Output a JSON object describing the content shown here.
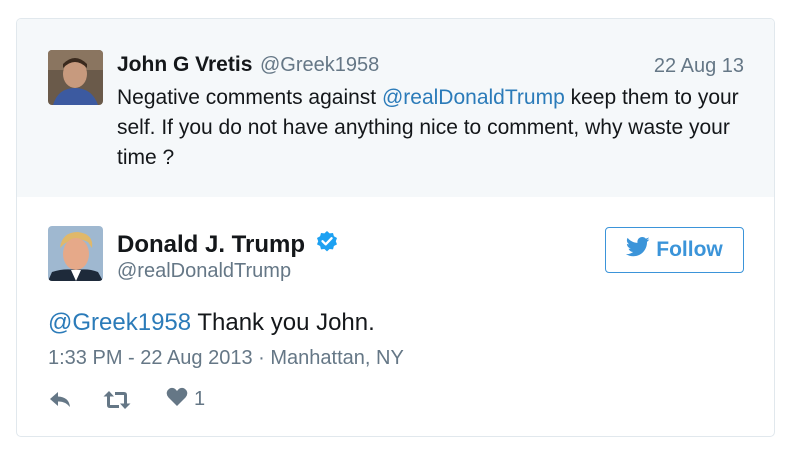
{
  "quoted": {
    "name": "John G Vretis",
    "handle": "@Greek1958",
    "date": "22 Aug 13",
    "text_before": "Negative comments against ",
    "mention": "@realDonaldTrump",
    "text_after": " keep them to your self. If you do not have anything nice to comment, why waste your time ?"
  },
  "tweet": {
    "name": "Donald J. Trump",
    "handle": "@realDonaldTrump",
    "follow_label": "Follow",
    "reply_mention": "@Greek1958",
    "text": " Thank you John.",
    "time": "1:33 PM - 22 Aug 2013",
    "separator": " · ",
    "location": "Manhattan, NY",
    "like_count": "1"
  },
  "colors": {
    "accent": "#3b94d9",
    "mention": "#2b7bb9",
    "muted": "#657786",
    "quoted_bg": "#f5f8fa"
  },
  "icons": [
    "reply-icon",
    "retweet-icon",
    "heart-icon",
    "twitter-bird-icon",
    "verified-badge-icon"
  ]
}
